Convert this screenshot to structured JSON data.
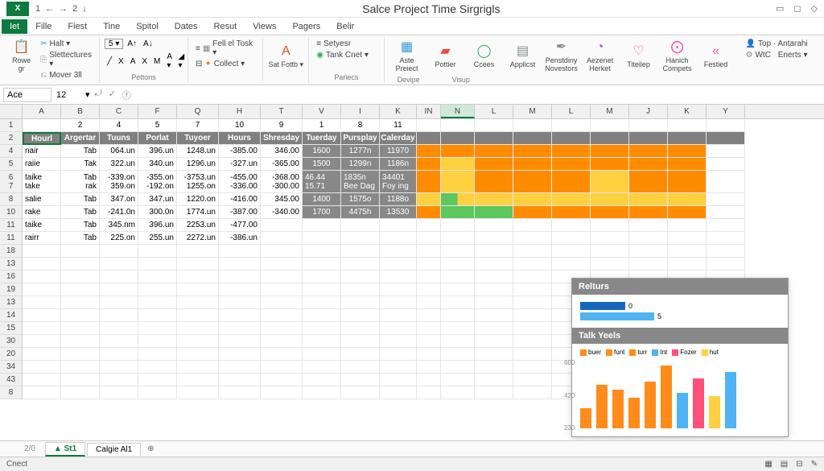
{
  "title": "Salce Project Time Sirgrigls",
  "quick_access": [
    "1",
    "←",
    "→",
    "2",
    "↓"
  ],
  "menus": {
    "file": "Iet",
    "items": [
      "Fille",
      "Fiest",
      "Tine",
      "Spitol",
      "Dates",
      "Resut",
      "Views",
      "Pagers",
      "Belir"
    ]
  },
  "ribbon": {
    "paste": {
      "label": "Rowe gr",
      "opt1": "Halt ▾",
      "opt2": "Slettectures ▾",
      "opt3": "Mover 3ll"
    },
    "font": {
      "size": "5 ▾",
      "row2": [
        "╱",
        "X",
        "A",
        "X",
        "M",
        "A ▾",
        "◢ ▾"
      ]
    },
    "align": {
      "opt1": "Fell el Tosk ▾",
      "opt2": "Collect ▾",
      "label": "Pettons"
    },
    "format": {
      "big": "Sat Fottb ▾",
      "opt1": "Setyesr",
      "opt2": "Tank Cnet ▾",
      "label": "Pariecs"
    },
    "btns": [
      {
        "label": "Aste Preiect",
        "color": "ic-blue",
        "glyph": "▦"
      },
      {
        "label": "Pottier",
        "color": "ic-red",
        "glyph": "▰"
      },
      {
        "label": "Ccees",
        "color": "ic-green",
        "glyph": "◯"
      },
      {
        "label": "Applicst",
        "color": "ic-gray",
        "glyph": "▤"
      },
      {
        "label": "Penstdiny Novestors",
        "color": "ic-gray",
        "glyph": "✒"
      },
      {
        "label": "Aezenet Herket",
        "color": "ic-purple",
        "glyph": "◔"
      },
      {
        "label": "Titeilep",
        "color": "ic-pink",
        "glyph": "♡"
      },
      {
        "label": "Hanich Compets",
        "color": "ic-pink",
        "glyph": "⨀"
      },
      {
        "label": "Festied",
        "color": "ic-pink",
        "glyph": "«"
      }
    ],
    "grp_labels": {
      "devipe": "Devipe",
      "visup": "Visup"
    },
    "right": {
      "top": "Top · Antarahi",
      "wtc": "WtC",
      "enerts": "Enerts ▾"
    }
  },
  "namebox": "Ace",
  "cellvalue": "12",
  "columns": [
    "A",
    "B",
    "C",
    "F",
    "Q",
    "H",
    "T",
    "V",
    "I",
    "K",
    "IN",
    "N",
    "L",
    "M",
    "L",
    "M",
    "J",
    "K",
    "Y"
  ],
  "col_widths": [
    "cw-A",
    "cw-B",
    "cw-C",
    "cw-F",
    "cw-Q",
    "cw-H",
    "cw-T",
    "cw-V",
    "cw-I",
    "cw-K",
    "cw-IN",
    "cw-N",
    "cw-L",
    "cw-M",
    "cw-L2",
    "cw-M2",
    "cw-J",
    "cw-K2",
    "cw-Y"
  ],
  "row_labels": [
    "1",
    "2",
    "4",
    "5",
    "6",
    "7",
    "8",
    "10",
    "11",
    "11",
    "18",
    "13",
    "16",
    "19",
    "13",
    "14",
    "15",
    "30",
    "20",
    "34",
    "43",
    "8"
  ],
  "active_col_index": 11,
  "header_row": [
    "",
    "2",
    "4",
    "5",
    "7",
    "10",
    "9",
    "1",
    "8",
    "11"
  ],
  "header2": [
    "Hourl",
    "Argertar",
    "Tuuns",
    "Porlat",
    "Tuyoer",
    "Hours",
    "Shresday",
    "Tuerday",
    "Pursplay",
    "Calerday"
  ],
  "rows": [
    {
      "a": "nair",
      "b": "Tab",
      "c": "064.un",
      "f": "396.un",
      "q": "1248.un",
      "h": "-385.00",
      "t": "346.00",
      "v": "1600",
      "i": "1277n",
      "k": "11970"
    },
    {
      "a": "raiie",
      "b": "Tak",
      "c": "322.un",
      "f": "340.un",
      "q": "1296.un",
      "h": "-327.un",
      "t": "-365.00",
      "v": "1500",
      "i": "1299n",
      "k": "1186n"
    },
    {
      "dbl": true,
      "a": "taike\ntake",
      "b": "Tab\nrak",
      "c": "-339.on\n359.on",
      "f": "-355.on\n-192.on",
      "q": "-3753.un\n1255.on",
      "h": "-455.00\n-336.00",
      "t": "-368.00\n-300.00",
      "v": "46.44\n15.71",
      "i": "1835n\nBee Dag",
      "k": "34401\nFoy ing"
    },
    {
      "a": "salie",
      "b": "Tab",
      "c": "347.on",
      "f": "347.un",
      "q": "1220.on",
      "h": "-416.00",
      "t": "345.00",
      "v": "1400",
      "i": "1575o",
      "k": "1188o"
    },
    {
      "a": "rake",
      "b": "Tab",
      "c": "-241.0n",
      "f": "300.0n",
      "q": "1774.un",
      "h": "-387.00",
      "t": "-340.00",
      "v": "1700",
      "i": "4475h",
      "k": "13530"
    },
    {
      "a": "taike",
      "b": "Tab",
      "c": "345.nm",
      "f": "396.un",
      "q": "2253.un",
      "h": "-477.00",
      "t": "",
      "v": "",
      "i": "",
      "k": ""
    },
    {
      "a": "rairr",
      "b": "Tab",
      "c": "225.on",
      "f": "255.un",
      "q": "2272.un",
      "h": "-386.un",
      "t": "",
      "v": "",
      "i": "",
      "k": ""
    }
  ],
  "heatmap": [
    [
      "orange",
      "orange",
      "orange",
      "orange",
      "orange",
      "orange",
      "orange",
      "orange"
    ],
    [
      "orange",
      "yellow",
      "orange",
      "orange",
      "orange",
      "orange",
      "orange",
      "orange"
    ],
    [
      "orange",
      "yellow",
      "orange",
      "orange",
      "orange",
      "yellow",
      "orange",
      "orange"
    ],
    [
      "yellow",
      "combo",
      "yellow",
      "yellow",
      "yellow",
      "yellow",
      "yellow",
      "yellow"
    ],
    [
      "orange",
      "green",
      "green",
      "orange",
      "orange",
      "orange",
      "orange",
      "orange"
    ]
  ],
  "panel": {
    "title1": "Relturs",
    "bars": [
      {
        "w": 56,
        "color": "#1565c0",
        "label": "0"
      },
      {
        "w": 92,
        "color": "#4fb3f4",
        "label": "5"
      }
    ],
    "title2": "Talk Yeels"
  },
  "chart_data": {
    "type": "bar",
    "title": "Talk Yeels",
    "ylim": [
      0,
      600
    ],
    "yticks": [
      600,
      420,
      230
    ],
    "legend": [
      {
        "name": "buer",
        "color": "#ff8c1a"
      },
      {
        "name": "funt",
        "color": "#ff8c1a"
      },
      {
        "name": "turr",
        "color": "#ff8c1a"
      },
      {
        "name": "Int",
        "color": "#4fb3f4"
      },
      {
        "name": "Fozer",
        "color": "#ff4f7b"
      },
      {
        "name": "hut",
        "color": "#ffd040"
      }
    ],
    "bars": [
      {
        "h": 25,
        "color": "#ff8c1a"
      },
      {
        "h": 54,
        "color": "#ff8c1a"
      },
      {
        "h": 48,
        "color": "#ff8c1a"
      },
      {
        "h": 38,
        "color": "#ff8c1a"
      },
      {
        "h": 58,
        "color": "#ff8c1a"
      },
      {
        "h": 78,
        "color": "#ff8c1a"
      },
      {
        "h": 44,
        "color": "#4fb3f4"
      },
      {
        "h": 62,
        "color": "#ff4f7b"
      },
      {
        "h": 40,
        "color": "#ffd040"
      },
      {
        "h": 70,
        "color": "#4fb3f4"
      }
    ]
  },
  "sheets": {
    "s1": "St1",
    "s2": "Calgie Al1",
    "num": "2/0"
  },
  "status": {
    "left": "Cnect"
  }
}
